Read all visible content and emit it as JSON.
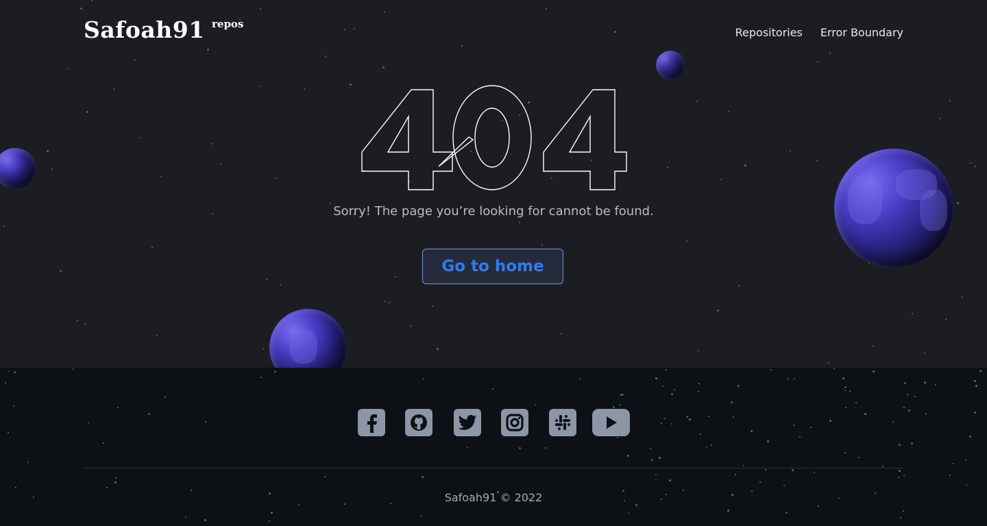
{
  "header": {
    "logo": {
      "main": "Safoah91",
      "sup": "repos"
    },
    "nav": [
      {
        "label": "Repositories"
      },
      {
        "label": "Error Boundary"
      }
    ]
  },
  "main": {
    "error_code": "404",
    "message": "Sorry! The page you’re looking for cannot be found.",
    "home_button": "Go to home"
  },
  "footer": {
    "social_icons": [
      "facebook-icon",
      "github-icon",
      "twitter-icon",
      "instagram-icon",
      "slack-icon",
      "youtube-icon"
    ],
    "copyright": "Safoah91 © 2022"
  },
  "colors": {
    "hero_bg": "#1c1d23",
    "footer_bg": "#0d1014",
    "accent": "#2f7bef",
    "icon": "#8c96a6"
  }
}
